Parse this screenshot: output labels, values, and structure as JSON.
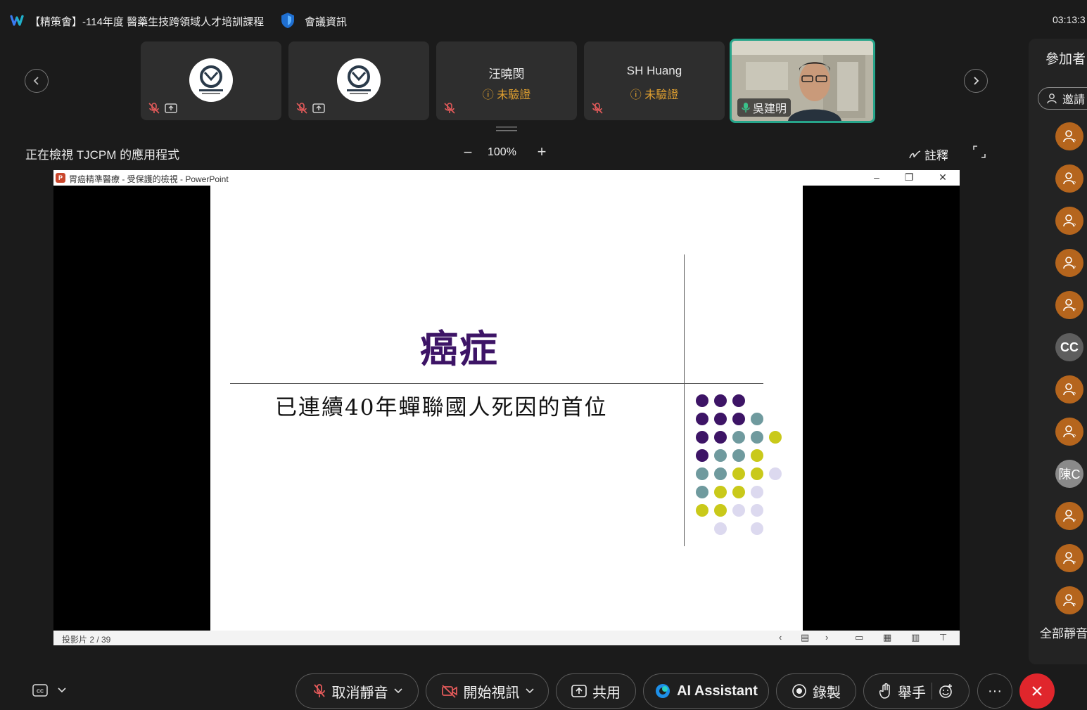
{
  "header": {
    "meeting_title": "【精策會】-114年度 醫藥生技跨領域人才培訓課程",
    "meeting_info": "會議資訊",
    "clock": "03:13:3"
  },
  "video_strip": {
    "tiles": [
      {
        "name": "",
        "status": "",
        "type": "logo"
      },
      {
        "name": "",
        "status": "",
        "type": "logo"
      },
      {
        "name": "汪曉閔",
        "status": "未驗證",
        "type": "text"
      },
      {
        "name": "SH Huang",
        "status": "未驗證",
        "type": "text"
      },
      {
        "name": "吳建明",
        "status": "",
        "type": "video"
      }
    ]
  },
  "view_bar": {
    "viewing_label": "正在檢視 TJCPM 的應用程式",
    "zoom_level": "100%",
    "annotate_label": "註釋"
  },
  "shared_window": {
    "title": "胃癌精準醫療  -  受保護的檢視 - PowerPoint",
    "slide_title": "癌症",
    "slide_subtitle": "已連續40年蟬聯國人死因的首位",
    "slide_counter": "投影片 2 / 39"
  },
  "participants_panel": {
    "title": "參加者",
    "invite_label": "邀請",
    "avatars": [
      {
        "kind": "user-icon"
      },
      {
        "kind": "user-icon"
      },
      {
        "kind": "user-icon"
      },
      {
        "kind": "user-icon"
      },
      {
        "kind": "user-icon"
      },
      {
        "kind": "initials",
        "text": "CC"
      },
      {
        "kind": "user-icon"
      },
      {
        "kind": "user-icon"
      },
      {
        "kind": "initials",
        "text": "陳C"
      },
      {
        "kind": "user-icon"
      },
      {
        "kind": "user-icon"
      },
      {
        "kind": "user-icon"
      }
    ],
    "mute_all_label": "全部靜音"
  },
  "toolbar": {
    "unmute_label": "取消靜音",
    "start_video_label": "開始視訊",
    "share_label": "共用",
    "ai_label": "AI Assistant",
    "record_label": "錄製",
    "raise_hand_label": "舉手",
    "more_label": "···"
  },
  "colors": {
    "accent_teal": "#27a58a",
    "leave_red": "#e0262c",
    "slide_title_purple": "#3d1466",
    "dot_purple": "#3d1466",
    "dot_teal": "#6f9a9e",
    "dot_yellow": "#c9c91a",
    "dot_lavender": "#dcd9ef"
  }
}
